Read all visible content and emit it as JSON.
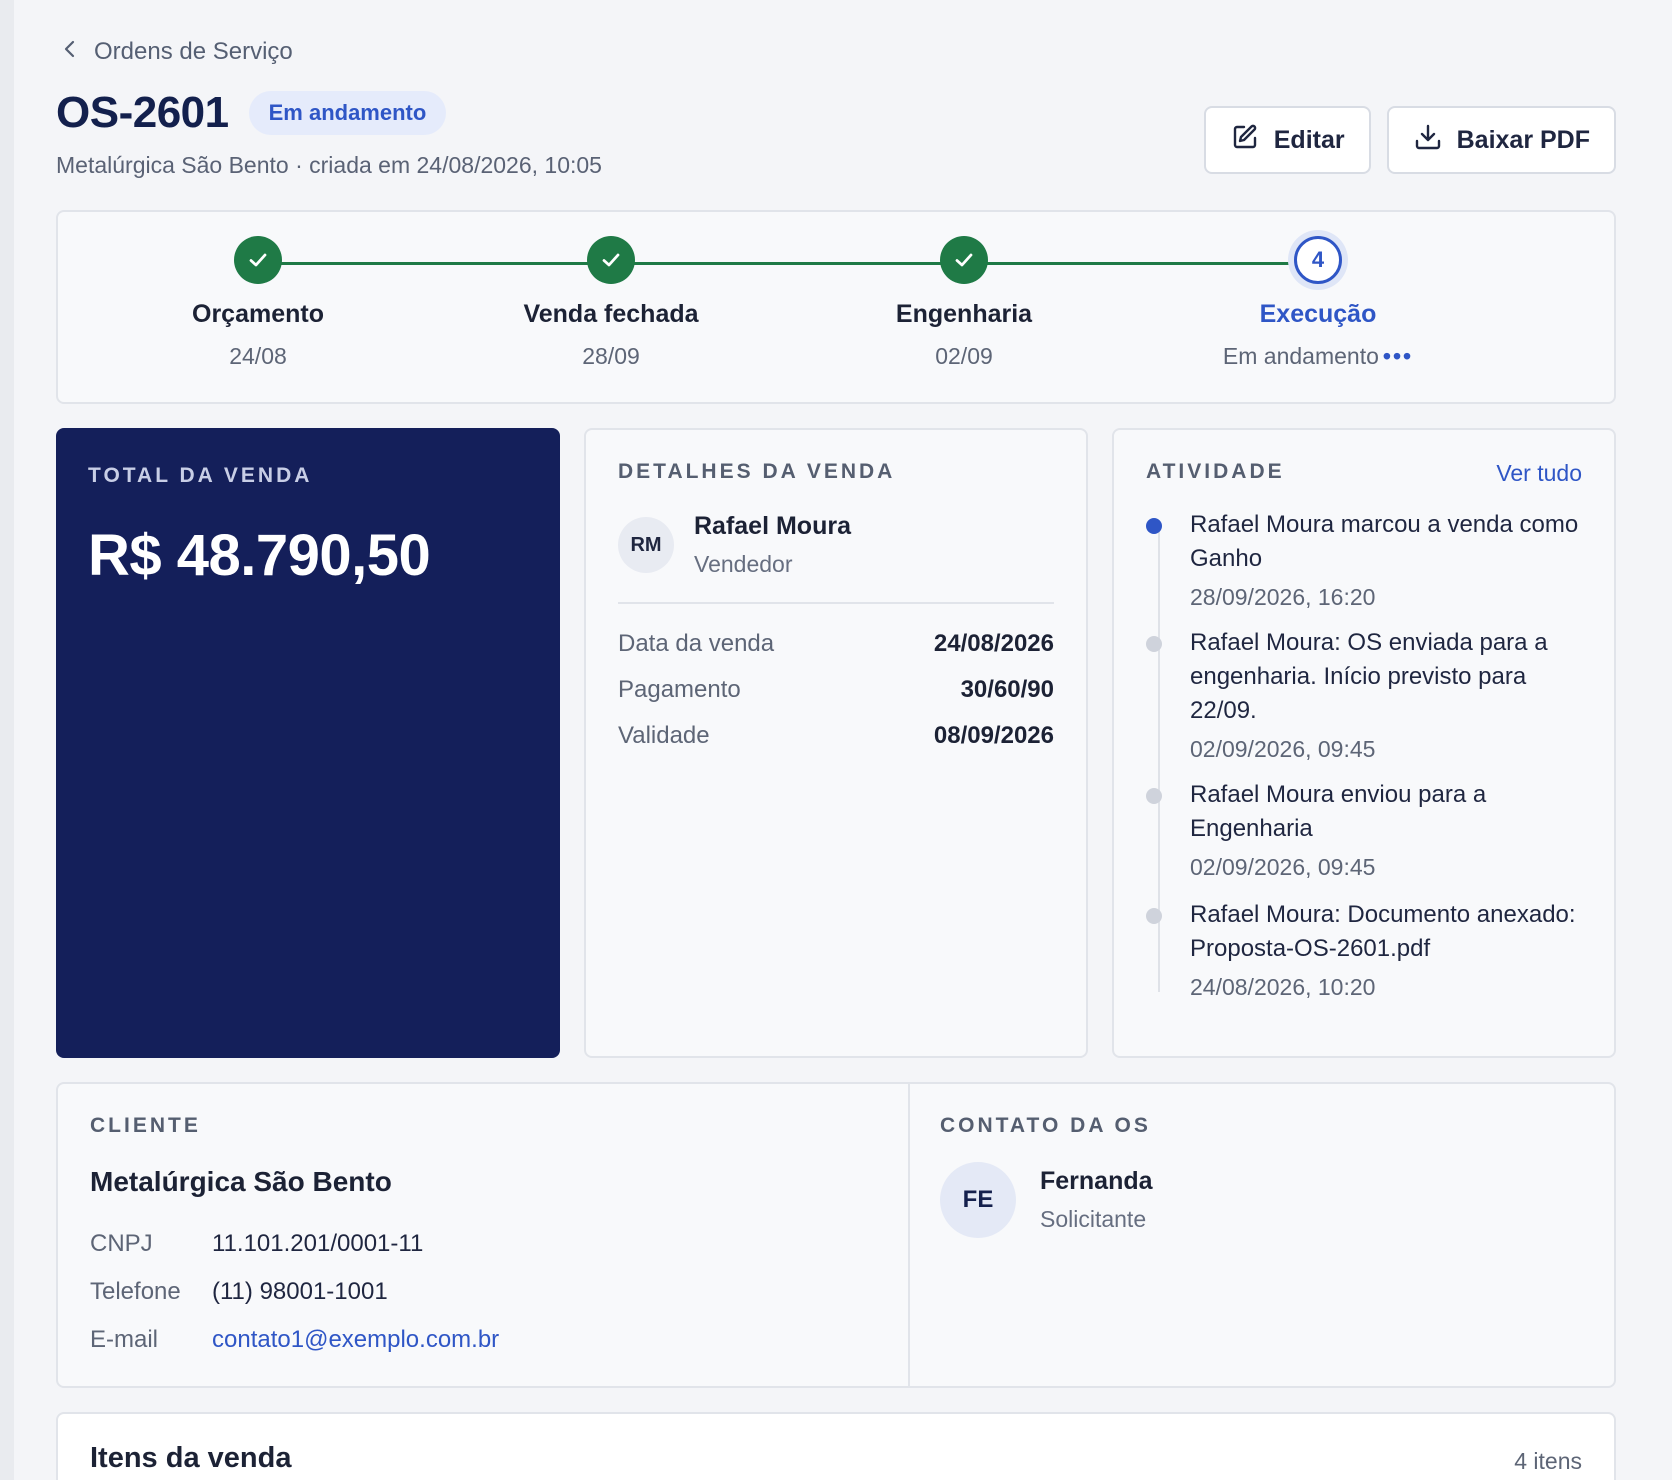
{
  "breadcrumb": {
    "label": "Ordens de Serviço"
  },
  "header": {
    "title": "OS-2601",
    "status": "Em andamento",
    "subtitle": "Metalúrgica São Bento · criada em 24/08/2026, 10:05"
  },
  "actions": {
    "edit_label": "Editar",
    "pdf_label": "Baixar PDF"
  },
  "stepper": {
    "steps": [
      {
        "label": "Orçamento",
        "date": "24/08",
        "state": "done"
      },
      {
        "label": "Venda fechada",
        "date": "28/09",
        "state": "done"
      },
      {
        "label": "Engenharia",
        "date": "02/09",
        "state": "done"
      },
      {
        "label": "Execução",
        "date": "Em andamento",
        "state": "current",
        "number": "4"
      }
    ]
  },
  "total": {
    "label": "TOTAL DA VENDA",
    "value": "R$ 48.790,50"
  },
  "details": {
    "label": "DETALHES DA VENDA",
    "seller": {
      "initials": "RM",
      "name": "Rafael Moura",
      "role": "Vendedor"
    },
    "rows": [
      {
        "key": "Data da venda",
        "value": "24/08/2026"
      },
      {
        "key": "Pagamento",
        "value": "30/60/90"
      },
      {
        "key": "Validade",
        "value": "08/09/2026"
      }
    ]
  },
  "activity": {
    "label": "ATIVIDADE",
    "see_all": "Ver tudo",
    "events": [
      {
        "text": "Rafael Moura marcou a venda como Ganho",
        "time": "28/09/2026, 16:20"
      },
      {
        "text": "Rafael Moura: OS enviada para a engenharia. Início previsto para 22/09.",
        "time": "02/09/2026, 09:45"
      },
      {
        "text": "Rafael Moura enviou para a Engenharia",
        "time": "02/09/2026, 09:45"
      },
      {
        "text": "Rafael Moura: Documento anexado: Proposta-OS-2601.pdf",
        "time": "24/08/2026, 10:20"
      }
    ]
  },
  "client": {
    "label": "CLIENTE",
    "name": "Metalúrgica São Bento",
    "rows": [
      {
        "key": "CNPJ",
        "value": "11.101.201/0001-11"
      },
      {
        "key": "Telefone",
        "value": "(11) 98001-1001"
      },
      {
        "key": "E-mail",
        "value": "contato1@exemplo.com.br"
      }
    ]
  },
  "contact": {
    "label": "CONTATO DA OS",
    "initials": "FE",
    "name": "Fernanda",
    "role": "Solicitante"
  },
  "items": {
    "title": "Itens da venda",
    "count": "4 itens"
  },
  "colors": {
    "navy": "#141f5a",
    "accent": "#2f56c6",
    "success": "#1f7a46"
  }
}
